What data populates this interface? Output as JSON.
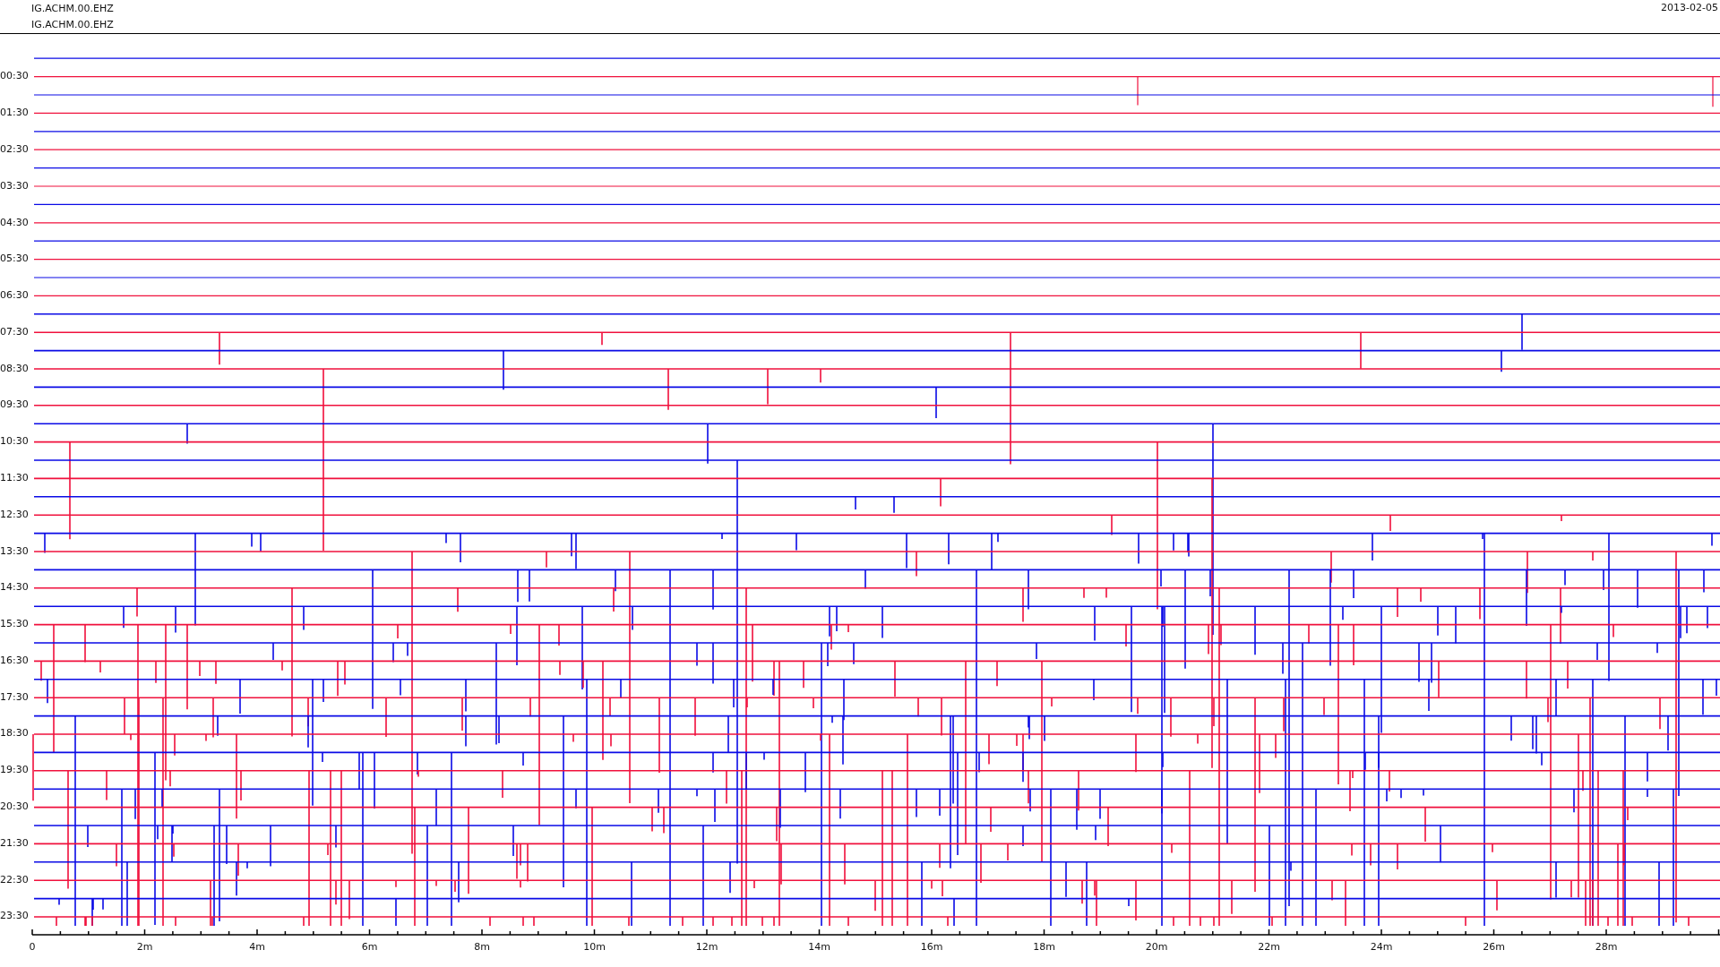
{
  "header": {
    "lines": [
      "IG.ACHM.00.EHZ",
      "IG.ACHM.00.EHZ"
    ],
    "date": "2013-02-05"
  },
  "helicorder": {
    "row_labels": [
      "00:30",
      "01:30",
      "02:30",
      "03:30",
      "04:30",
      "05:30",
      "06:30",
      "07:30",
      "08:30",
      "09:30",
      "10:30",
      "11:30",
      "12:30",
      "13:30",
      "14:30",
      "15:30",
      "16:30",
      "17:30",
      "18:30",
      "19:30",
      "20:30",
      "21:30",
      "22:30",
      "23:30"
    ],
    "x_tick_labels": [
      "0",
      "2m",
      "4m",
      "6m",
      "8m",
      "10m",
      "12m",
      "14m",
      "16m",
      "18m",
      "20m",
      "22m",
      "24m",
      "26m",
      "28m"
    ]
  }
}
